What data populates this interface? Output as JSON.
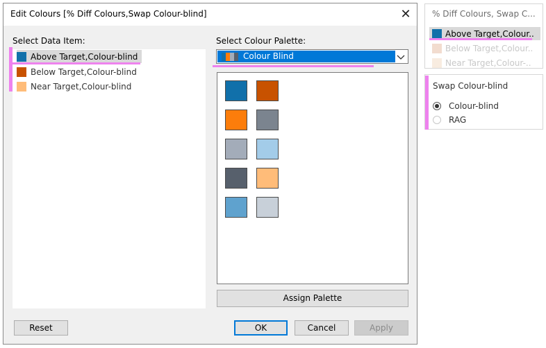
{
  "dialog": {
    "title": "Edit Colours [% Diff Colours,Swap Colour-blind]",
    "data_item_label": "Select Data Item:",
    "palette_label": "Select Colour Palette:",
    "items": [
      {
        "label": "Above Target,Colour-blind",
        "color": "#1170aa",
        "selected": true
      },
      {
        "label": "Below Target,Colour-blind",
        "color": "#c85200",
        "selected": false
      },
      {
        "label": "Near Target,Colour-blind",
        "color": "#ffbc79",
        "selected": false
      }
    ],
    "palette_selected": "Colour Blind",
    "palette_icon_colors": [
      "#1170aa",
      "#fc7d0b",
      "#a3acb9",
      "#57606c"
    ],
    "swatches": [
      "#1170aa",
      "#c85200",
      "#fc7d0b",
      "#7b848f",
      "#a3acb9",
      "#a3cce9",
      "#57606c",
      "#ffbc79",
      "#5fa2ce",
      "#c8d0d9"
    ],
    "assign_label": "Assign Palette",
    "reset_label": "Reset",
    "ok_label": "OK",
    "cancel_label": "Cancel",
    "apply_label": "Apply"
  },
  "legend": {
    "title": "% Diff Colours, Swap C...",
    "items": [
      {
        "label": "Above Target,Colour..",
        "color": "#1170aa",
        "faded": false
      },
      {
        "label": "Below Target,Colour..",
        "color": "#f2dccf",
        "faded": true
      },
      {
        "label": "Near Target,Colour-..",
        "color": "#f8ece0",
        "faded": true
      }
    ]
  },
  "param": {
    "title": "Swap Colour-blind",
    "options": [
      {
        "label": "Colour-blind",
        "checked": true
      },
      {
        "label": "RAG",
        "checked": false
      }
    ]
  },
  "highlight_color": "#ee82ee"
}
